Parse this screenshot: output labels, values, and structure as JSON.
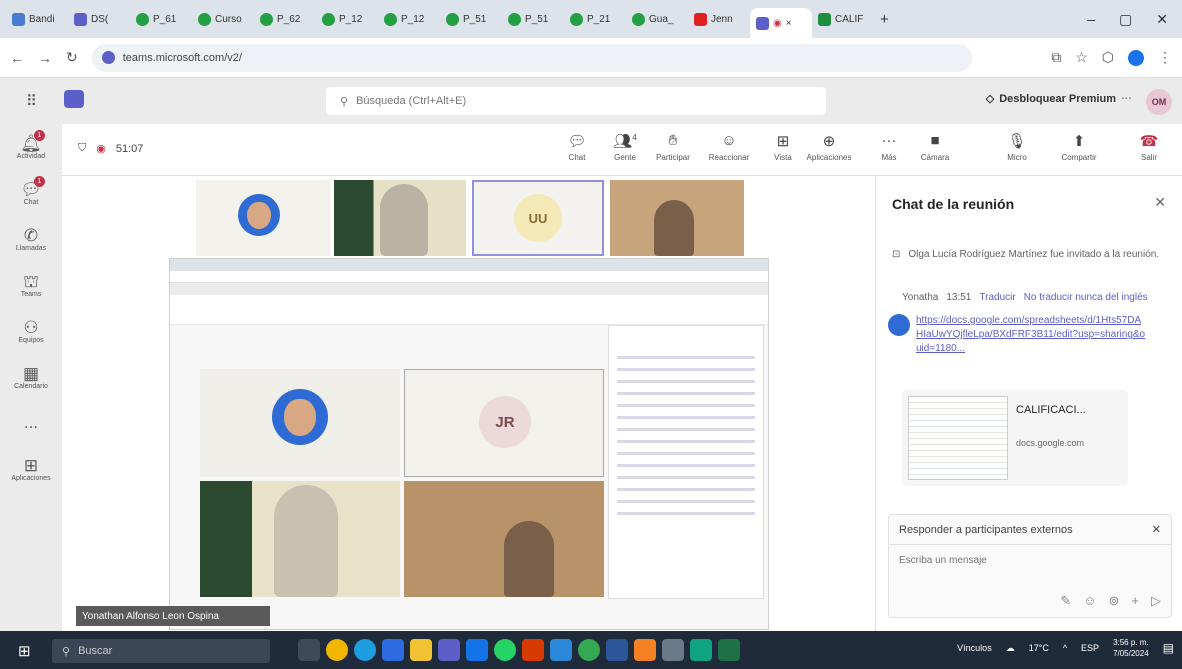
{
  "browser": {
    "tabs": [
      {
        "label": "Bandi",
        "color": "#4a7bd0"
      },
      {
        "label": "DS(",
        "color": "#5b5fc7"
      },
      {
        "label": "P_61",
        "color": "#22a043"
      },
      {
        "label": "Curso",
        "color": "#22a043"
      },
      {
        "label": "P_62",
        "color": "#22a043"
      },
      {
        "label": "P_12",
        "color": "#22a043"
      },
      {
        "label": "P_12",
        "color": "#22a043"
      },
      {
        "label": "P_51",
        "color": "#22a043"
      },
      {
        "label": "P_51",
        "color": "#22a043"
      },
      {
        "label": "P_21",
        "color": "#22a043"
      },
      {
        "label": "Gua_",
        "color": "#22a043"
      },
      {
        "label": "Jenn",
        "color": "#e02020"
      },
      {
        "label": "",
        "color": "#5b5fc7"
      },
      {
        "label": "CALIF",
        "color": "#1e8e3e"
      }
    ],
    "url": "teams.microsoft.com/v2/"
  },
  "teams": {
    "search_placeholder": "Búsqueda (Ctrl+Alt+E)",
    "premium_label": "Desbloquear Premium",
    "avatar_initials": "OM",
    "rail": [
      {
        "label": "Actividad",
        "icon": "bell-icon",
        "badge": "1"
      },
      {
        "label": "Chat",
        "icon": "chat-icon",
        "badge": "1"
      },
      {
        "label": "Llamadas",
        "icon": "phone-icon"
      },
      {
        "label": "Teams",
        "icon": "teams-icon"
      },
      {
        "label": "Equipos",
        "icon": "people-icon"
      },
      {
        "label": "Calendario",
        "icon": "calendar-icon"
      },
      {
        "label": "...",
        "icon": "more-icon"
      },
      {
        "label": "Aplicaciones",
        "icon": "apps-icon"
      }
    ],
    "meeting": {
      "timer": "51:07",
      "controls": {
        "chat": "Chat",
        "people": "Gente",
        "people_count": "4",
        "raise": "Participar",
        "react": "Reaccionar",
        "view": "Vista",
        "apps": "Aplicaciones",
        "more": "Más",
        "camera": "Cámara",
        "mic": "Micro",
        "share": "Compartir",
        "leave": "Salir"
      }
    },
    "participants": {
      "uu_initials": "UU",
      "jr_initials": "JR",
      "name_bar": "Yonathan Alfonso Leon Ospina"
    },
    "chat": {
      "title": "Chat de la reunión",
      "system_msg": "Olga Lucía Rodríguez Martínez fue invitado a la reunión.",
      "sender": "Yonatha",
      "time": "13:51",
      "translate": "Traducir",
      "no_translate": "No traducir nunca del inglés",
      "link": "https://docs.google.com/spreadsheets/d/1Hts57DAHIaUwYQjfleLpa/BXdFRF3B11/edit?usp=sharing&ouid=1180...",
      "card_title": "CALIFICACI...",
      "card_domain": "docs.google.com",
      "reply_header": "Responder a participantes externos",
      "reply_placeholder": "Escriba un mensaje"
    }
  },
  "taskbar": {
    "search_label": "Buscar",
    "weather": "17°C",
    "tray_label": "Vínculos",
    "lang": "ESP",
    "time": "3:56 p. m.",
    "date": "7/05/2024"
  }
}
